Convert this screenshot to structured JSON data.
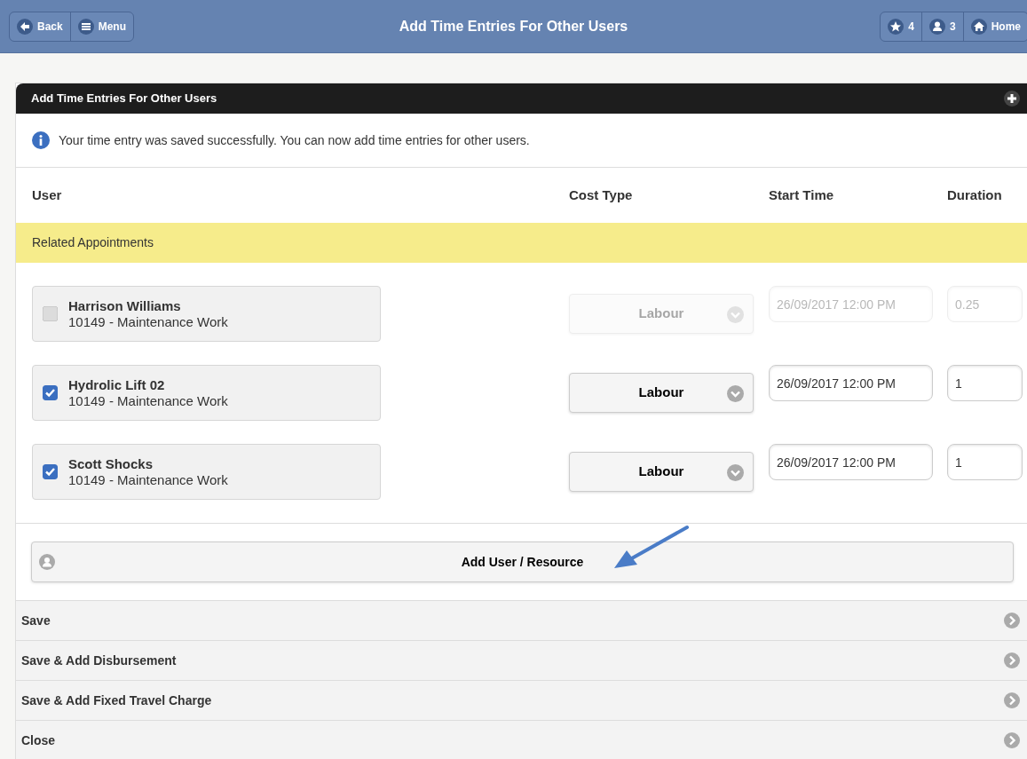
{
  "header": {
    "back": "Back",
    "menu": "Menu",
    "title": "Add Time Entries For Other Users",
    "favorites": "4",
    "users": "3",
    "home": "Home"
  },
  "panel": {
    "title": "Add Time Entries For Other Users",
    "info": "Your time entry was saved successfully. You can now add time entries for other users.",
    "columns": [
      "User",
      "Cost Type",
      "Start Time",
      "Duration"
    ],
    "group": "Related Appointments",
    "entries": [
      {
        "name": "Harrison Williams",
        "job": "10149 - Maintenance Work",
        "checked": false,
        "disabled": true,
        "cost_type": "Labour",
        "start": "26/09/2017 12:00 PM",
        "duration": "0.25"
      },
      {
        "name": "Hydrolic Lift 02",
        "job": "10149 - Maintenance Work",
        "checked": true,
        "disabled": false,
        "cost_type": "Labour",
        "start": "26/09/2017 12:00 PM",
        "duration": "1"
      },
      {
        "name": "Scott Shocks",
        "job": "10149 - Maintenance Work",
        "checked": true,
        "disabled": false,
        "cost_type": "Labour",
        "start": "26/09/2017 12:00 PM",
        "duration": "1"
      }
    ],
    "add_button": "Add User / Resource",
    "actions": [
      "Save",
      "Save & Add Disbursement",
      "Save & Add Fixed Travel Charge",
      "Close"
    ]
  }
}
